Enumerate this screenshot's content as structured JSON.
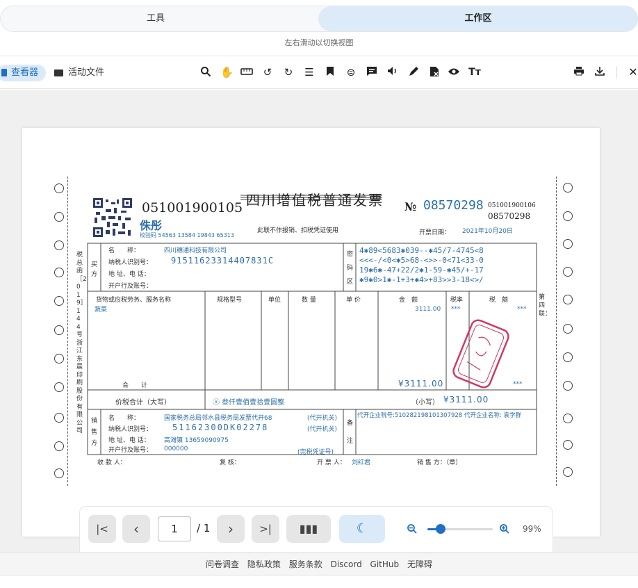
{
  "tabs": {
    "tools": "工具",
    "workspace": "工作区"
  },
  "hint": "左右滑动以切换视图",
  "toolbar": {
    "viewer": "查看器",
    "active_files": "活动文件"
  },
  "invoice": {
    "title": "四川增值税普通发票",
    "code": "051001900105",
    "no_label": "№",
    "number": "08570298",
    "side_code": "051001900106",
    "side_number": "08570298",
    "stamp_text": "侏彤",
    "check_code": "校验码 54563 13584 19843 65313",
    "note": "此联不作报销、扣税凭证使用",
    "date_label": "开票日期：",
    "date": "2021年10月20日",
    "buyer_side": "买方",
    "buyer_name_label": "名　　称：",
    "buyer_name": "四川穗通科技有限公司",
    "buyer_tax_label": "纳税人识别号：",
    "buyer_tax": "91511623314407831C",
    "buyer_addr_label": "地 址、电 话：",
    "buyer_bank_label": "开户行及账号：",
    "cipher_side": "密码区",
    "cipher": [
      "4✱89<5683✱039--✱45/7-4745<8",
      "<<<-/<0<✱5>68-<>>-0<71<33-0",
      "19✱6✱-47+22/2✱1-59-✱45/+-17",
      "✱9✱0>1✱-1+3+✱4>+83>>3-18<>/"
    ],
    "col_goods": "货物或应税劳务、服务名称",
    "col_spec": "规格型号",
    "col_unit": "单位",
    "col_qty": "数 量",
    "col_price": "单 价",
    "col_amount": "金　额",
    "col_rate": "税率",
    "col_tax": "税　额",
    "item_name": "蔬菜",
    "item_amount": "3111.00",
    "item_rate": "***",
    "item_tax": "***",
    "total_label": "合　　计",
    "total_amount": "¥3111.00",
    "total_tax": "***",
    "tax_total_label": "价税合计（大写）",
    "tax_total_words": "ⓧ 叁仟壹佰壹拾壹圆整",
    "tax_total_small_label": "（小写）",
    "tax_total_small": "¥3111.00",
    "seller_side": "销售方",
    "seller_name_label": "名　　称：",
    "seller_name": "国家税务总局邻水县税务局发票代开68",
    "seller_agent1": "(代开机关)",
    "seller_tax_label": "纳税人识别号：",
    "seller_tax": "51162300DK02278",
    "seller_agent2": "(代开机关)",
    "seller_addr_label": "地 址、电 话：",
    "seller_addr": "高滩镇 13659090975",
    "seller_bank_label": "开户行及账号：",
    "seller_bank": "000000",
    "seller_cert": "(完税凭证号)",
    "remark_side": "备注",
    "remark": "代开企业税号:510282198101307928 代开企业名称: 袁学群",
    "payee_label": "收 款 人：",
    "reviewer_label": "复 核：",
    "drawer_label": "开 票 人：",
    "drawer": "刘红君",
    "seller_sign_label": "销 售 方：（章）",
    "left_strip": "税总函［2019］144号浙江东晨印刷股份有限公司",
    "right_strip": "第四联："
  },
  "pager": {
    "page": "1",
    "total": "/ 1",
    "zoom": "99%",
    "zoom_level": 0.2
  },
  "footer": [
    "问卷调查",
    "隐私政策",
    "服务条款",
    "Discord",
    "GitHub",
    "无障碍"
  ]
}
